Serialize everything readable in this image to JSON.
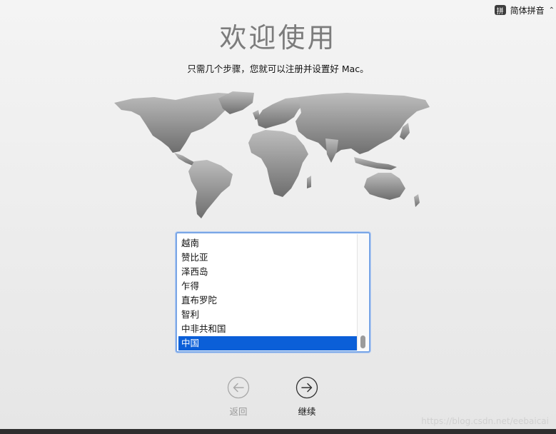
{
  "input_menu": {
    "badge": "拼",
    "label": "简体拼音",
    "chevron": "⌃⌄"
  },
  "title": "欢迎使用",
  "subtitle": "只需几个步骤，您就可以注册并设置好 Mac。",
  "country_list": {
    "items": [
      "越南",
      "赞比亚",
      "泽西岛",
      "乍得",
      "直布罗陀",
      "智利",
      "中非共和国",
      "中国"
    ],
    "selected": "中国"
  },
  "buttons": {
    "back_label": "返回",
    "continue_label": "继续"
  },
  "watermark": "https://blog.csdn.net/eebaicai",
  "colors": {
    "selection": "#0b5fd8",
    "map": "#8a8a8a",
    "focus_ring": "#7aa6e6"
  },
  "icons": {
    "back": "arrow-left-circle-icon",
    "continue": "arrow-right-circle-icon"
  }
}
